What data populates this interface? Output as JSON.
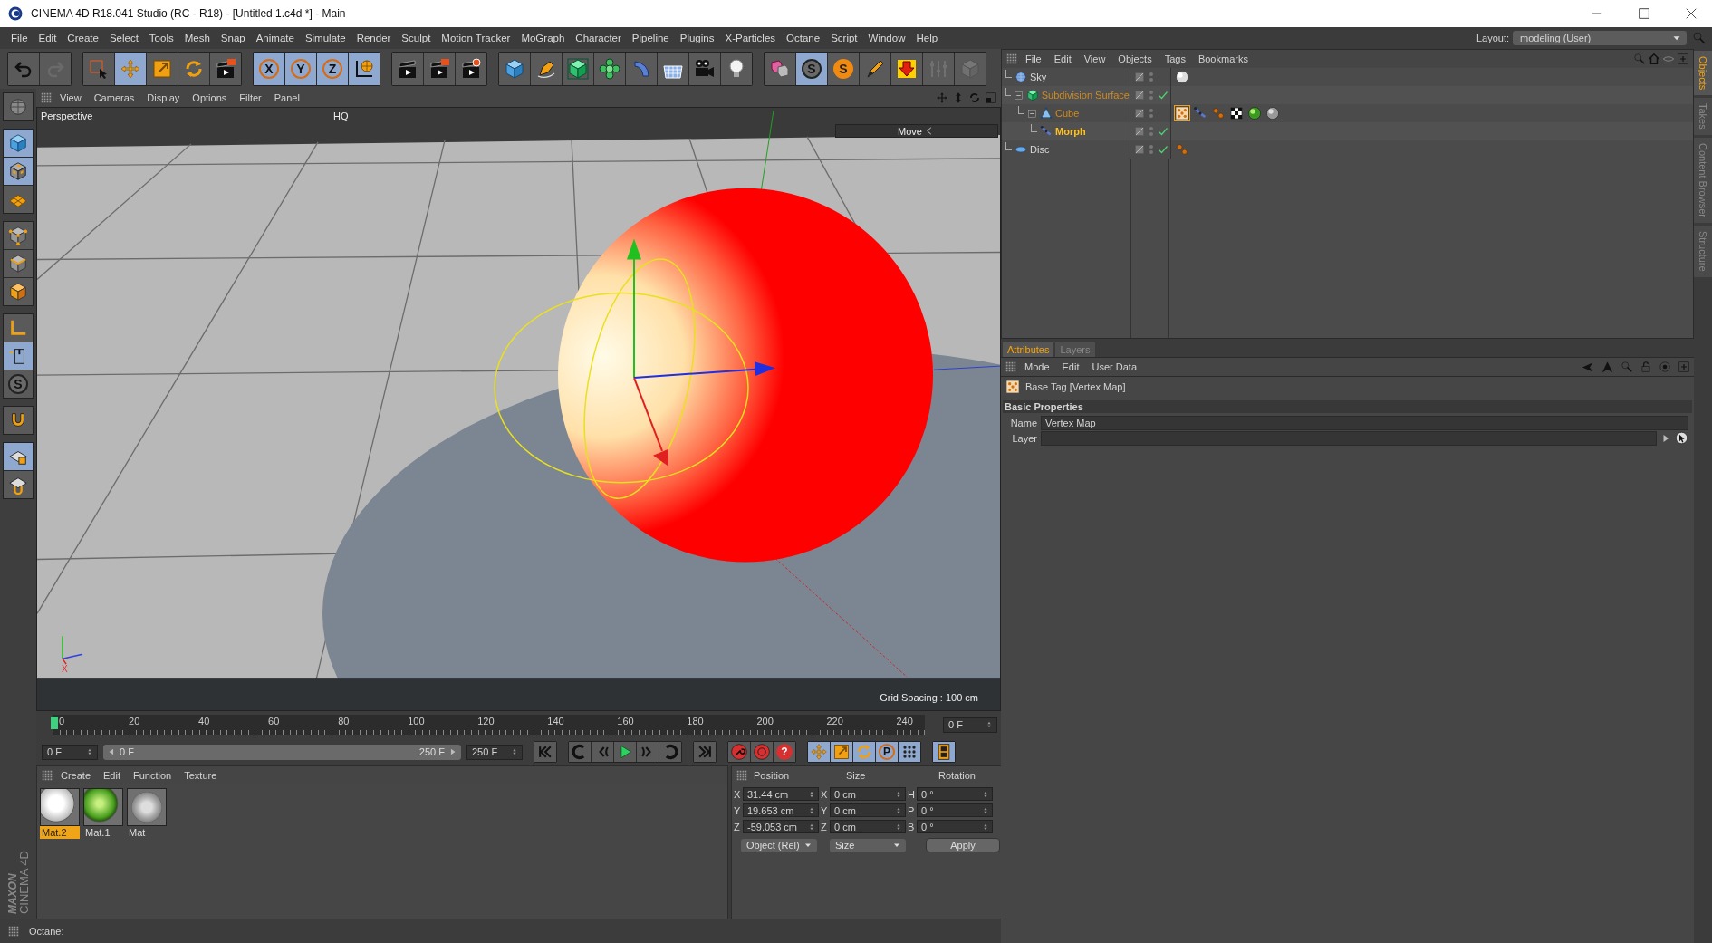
{
  "window": {
    "title": "CINEMA 4D R18.041 Studio (RC - R18) - [Untitled 1.c4d *] - Main"
  },
  "menu": [
    "File",
    "Edit",
    "Create",
    "Select",
    "Tools",
    "Mesh",
    "Snap",
    "Animate",
    "Simulate",
    "Render",
    "Sculpt",
    "Motion Tracker",
    "MoGraph",
    "Character",
    "Pipeline",
    "Plugins",
    "X-Particles",
    "Octane",
    "Script",
    "Window",
    "Help"
  ],
  "layout": {
    "label": "Layout:",
    "value": "modeling (User)"
  },
  "toolbar": [
    [
      {
        "kind": "undo",
        "on": false,
        "disabled": false
      },
      {
        "kind": "redo",
        "on": false,
        "disabled": true
      }
    ],
    [
      {
        "kind": "select",
        "on": false,
        "disabled": false
      },
      {
        "kind": "move",
        "on": true,
        "disabled": false
      },
      {
        "kind": "scale",
        "on": false,
        "disabled": false
      },
      {
        "kind": "rotate",
        "on": false,
        "disabled": false
      },
      {
        "kind": "clapper-red",
        "on": false,
        "disabled": false
      }
    ],
    [
      {
        "kind": "letter-ring",
        "label": "X",
        "on": true,
        "disabled": false
      },
      {
        "kind": "letter-ring",
        "label": "Y",
        "on": true,
        "disabled": false
      },
      {
        "kind": "letter-ring",
        "label": "Z",
        "on": true,
        "disabled": false
      },
      {
        "kind": "axes-globe",
        "on": true,
        "disabled": false
      }
    ],
    [
      {
        "kind": "clapper",
        "on": false,
        "disabled": false
      },
      {
        "kind": "clapper-red",
        "on": false,
        "disabled": false
      },
      {
        "kind": "clapper-gear",
        "on": false,
        "disabled": false
      }
    ],
    [
      {
        "kind": "cube",
        "on": false,
        "disabled": false
      },
      {
        "kind": "pen",
        "on": false,
        "disabled": false
      },
      {
        "kind": "subdiv",
        "on": false,
        "disabled": false
      },
      {
        "kind": "cloner",
        "on": false,
        "disabled": false
      },
      {
        "kind": "deformer",
        "on": false,
        "disabled": false
      },
      {
        "kind": "floor",
        "on": false,
        "disabled": false
      },
      {
        "kind": "camera",
        "on": false,
        "disabled": false
      },
      {
        "kind": "light",
        "on": false,
        "disabled": false
      }
    ],
    [
      {
        "kind": "tagcubes",
        "on": false,
        "disabled": false
      },
      {
        "kind": "letter-disc",
        "label": "S",
        "on": true,
        "disabled": false
      },
      {
        "kind": "letter-orange",
        "label": "S",
        "on": false,
        "disabled": false
      },
      {
        "kind": "brush",
        "on": false,
        "disabled": false
      },
      {
        "kind": "snaparrow",
        "on": false,
        "disabled": false
      },
      {
        "kind": "sliders",
        "on": false,
        "disabled": true
      },
      {
        "kind": "greycube",
        "on": false,
        "disabled": true
      }
    ]
  ],
  "left_toolbar": [
    [
      {
        "kind": "sphere-grid",
        "on": false
      }
    ],
    [
      {
        "kind": "cube",
        "on": true
      },
      {
        "kind": "checker-cube",
        "on": true
      },
      {
        "kind": "grid-plane",
        "on": false
      }
    ],
    [
      {
        "kind": "cube-points",
        "on": false
      },
      {
        "kind": "cube-edges",
        "on": false
      },
      {
        "kind": "cube-faces",
        "on": false
      }
    ],
    [
      {
        "kind": "axis-corner",
        "on": false
      },
      {
        "kind": "mouse",
        "on": true
      },
      {
        "kind": "letter-disc",
        "label": "S",
        "on": false
      }
    ],
    [
      {
        "kind": "magnet",
        "on": false
      }
    ],
    [
      {
        "kind": "lockgrid",
        "on": true
      },
      {
        "kind": "gridmag",
        "on": false
      }
    ]
  ],
  "logo": {
    "brand": "MAXON",
    "product": "CINEMA 4D"
  },
  "viewport": {
    "menu": [
      "View",
      "Cameras",
      "Display",
      "Options",
      "Filter",
      "Panel"
    ],
    "camera": "Perspective",
    "quality": "HQ",
    "tool": "Move",
    "grid_spacing": "Grid Spacing : 100 cm",
    "axis_label": "X"
  },
  "timeline": {
    "level": 0,
    "ruler": [
      "0",
      "20",
      "40",
      "60",
      "80",
      "100",
      "120",
      "140",
      "160",
      "180",
      "200",
      "220",
      "240"
    ],
    "current": "0 F",
    "start": "0 F",
    "range": {
      "start": "0 F",
      "end": "250 F",
      "level": 1
    },
    "end": "250 F",
    "controls": [
      [
        {
          "kind": "skip-start",
          "on": false
        }
      ],
      [
        {
          "kind": "prev-key",
          "on": false
        },
        {
          "kind": "step-back",
          "on": false
        },
        {
          "kind": "play",
          "on": false
        },
        {
          "kind": "step-forward",
          "on": false
        },
        {
          "kind": "next-key",
          "on": false
        }
      ],
      [
        {
          "kind": "skip-end",
          "on": false
        }
      ],
      [
        {
          "kind": "key-record",
          "on": false
        },
        {
          "kind": "auto-key",
          "on": false
        },
        {
          "kind": "letter-red",
          "label": "?",
          "on": false
        }
      ],
      [
        {
          "kind": "move",
          "on": true
        },
        {
          "kind": "scale",
          "on": true
        },
        {
          "kind": "rotate",
          "on": true
        },
        {
          "kind": "letter-ring",
          "label": "P",
          "on": true
        },
        {
          "kind": "dots",
          "on": true
        }
      ],
      [
        {
          "kind": "filmstrip",
          "on": true
        }
      ]
    ]
  },
  "materials": {
    "menu": [
      "Create",
      "Edit",
      "Function",
      "Texture"
    ],
    "items": [
      {
        "name": "Mat.2",
        "kind": "white",
        "selected": true
      },
      {
        "name": "Mat.1",
        "kind": "green",
        "selected": false
      },
      {
        "name": "Mat",
        "kind": "noise",
        "selected": false
      }
    ]
  },
  "coordinates": {
    "headers": [
      "Position",
      "Size",
      "Rotation"
    ],
    "rows": [
      [
        {
          "axis": "X",
          "value": "31.44 cm"
        },
        {
          "axis": "X",
          "value": "0 cm"
        },
        {
          "axis": "H",
          "value": "0 °"
        }
      ],
      [
        {
          "axis": "Y",
          "value": "19.653 cm"
        },
        {
          "axis": "Y",
          "value": "0 cm"
        },
        {
          "axis": "P",
          "value": "0 °"
        }
      ],
      [
        {
          "axis": "Z",
          "value": "-59.053 cm"
        },
        {
          "axis": "Z",
          "value": "0 cm"
        },
        {
          "axis": "B",
          "value": "0 °"
        }
      ]
    ],
    "mode": "Object (Rel)",
    "size_mode": "Size",
    "apply": "Apply"
  },
  "status_bar": "Octane:",
  "objects": {
    "menu": [
      "File",
      "Edit",
      "View",
      "Objects",
      "Tags",
      "Bookmarks"
    ],
    "tree": [
      {
        "name": "Sky",
        "kind": "sky",
        "selected": false,
        "active": false,
        "enabled": false,
        "tags": [
          {
            "kind": "mat-white",
            "selected": false
          }
        ]
      },
      {
        "name": "Subdivision Surface",
        "kind": "subdivision",
        "selected": true,
        "active": false,
        "enabled": true,
        "expanded": true,
        "children": [
          {
            "name": "Cube",
            "kind": "polygon",
            "selected": true,
            "active": false,
            "enabled": false,
            "expanded": true,
            "tags": [
              {
                "kind": "vertexmap",
                "selected": true
              },
              {
                "kind": "ik",
                "selected": false
              },
              {
                "kind": "pose",
                "selected": false
              },
              {
                "kind": "checker",
                "selected": false
              },
              {
                "kind": "mat-green",
                "selected": false
              },
              {
                "kind": "mat-noise",
                "selected": false
              }
            ],
            "children": [
              {
                "name": "Morph",
                "kind": "morph",
                "selected": true,
                "active": true,
                "enabled": true
              }
            ]
          }
        ]
      },
      {
        "name": "Disc",
        "kind": "disc",
        "selected": false,
        "active": false,
        "enabled": true,
        "tags": [
          {
            "kind": "pose",
            "selected": false
          }
        ]
      }
    ]
  },
  "side_tabs": [
    {
      "label": "Objects",
      "selected": true
    },
    {
      "label": "Takes",
      "selected": false
    },
    {
      "label": "Content Browser",
      "selected": false
    },
    {
      "label": "Structure",
      "selected": false
    }
  ],
  "attributes": {
    "tabs": [
      {
        "label": "Attributes",
        "selected": true
      },
      {
        "label": "Layers",
        "selected": false
      }
    ],
    "menu": [
      "Mode",
      "Edit",
      "User Data"
    ],
    "title": "Base Tag [Vertex Map]",
    "section": "Basic Properties",
    "fields": [
      {
        "label": "Name",
        "kind": "text",
        "value": "Vertex Map"
      },
      {
        "label": "Layer",
        "kind": "link"
      }
    ]
  }
}
